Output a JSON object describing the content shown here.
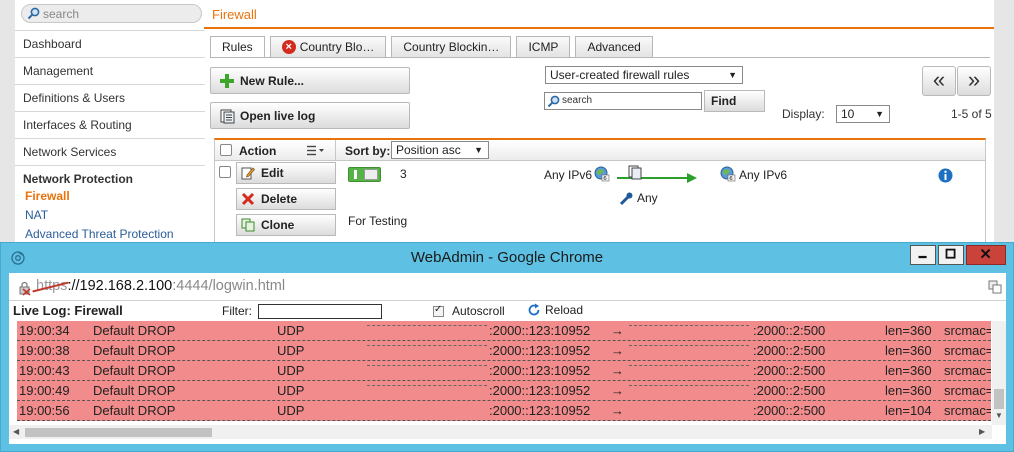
{
  "search": {
    "placeholder": "search"
  },
  "nav": {
    "items": [
      "Dashboard",
      "Management",
      "Definitions & Users",
      "Interfaces & Routing",
      "Network Services"
    ],
    "group": "Network Protection",
    "subitems": [
      "Firewall",
      "NAT",
      "Advanced Threat Protection"
    ]
  },
  "breadcrumb": "Firewall",
  "tabs": [
    "Rules",
    "Country Blo…",
    "Country Blockin…",
    "ICMP",
    "Advanced"
  ],
  "toolbar": {
    "new_rule": "New Rule...",
    "open_live_log": "Open live log",
    "filter_select": "User-created firewall rules",
    "search_placeholder": "search",
    "find": "Find",
    "display_label": "Display:",
    "display_value": "10",
    "range": "1-5 of 5",
    "prev": "«",
    "next": "»"
  },
  "table": {
    "action_header": "Action",
    "sort_label": "Sort by:",
    "sort_value": "Position asc",
    "row": {
      "edit": "Edit",
      "delete": "Delete",
      "clone": "Clone",
      "position": "3",
      "source": "Any IPv6",
      "service": "Any",
      "destination": "Any IPv6",
      "comment": "For Testing"
    }
  },
  "popup": {
    "title": "WebAdmin - Google Chrome",
    "url_scheme": "https",
    "url_host": "://192.168.2.100",
    "url_path": ":4444/logwin.html",
    "log_title": "Live Log: Firewall",
    "filter_label": "Filter:",
    "autoscroll": "Autoscroll",
    "reload": "Reload",
    "rows": [
      {
        "time": "19:00:34",
        "action": "Default DROP",
        "proto": "UDP",
        "src": ":2000::123:10952",
        "arrow": "→",
        "dst": ":2000::2:500",
        "len": "len=360",
        "extra": "srcmac="
      },
      {
        "time": "19:00:38",
        "action": "Default DROP",
        "proto": "UDP",
        "src": ":2000::123:10952",
        "arrow": "→",
        "dst": ":2000::2:500",
        "len": "len=360",
        "extra": "srcmac="
      },
      {
        "time": "19:00:43",
        "action": "Default DROP",
        "proto": "UDP",
        "src": ":2000::123:10952",
        "arrow": "→",
        "dst": ":2000::2:500",
        "len": "len=360",
        "extra": "srcmac="
      },
      {
        "time": "19:00:49",
        "action": "Default DROP",
        "proto": "UDP",
        "src": ":2000::123:10952",
        "arrow": "→",
        "dst": ":2000::2:500",
        "len": "len=360",
        "extra": "srcmac="
      },
      {
        "time": "19:00:56",
        "action": "Default DROP",
        "proto": "UDP",
        "src": ":2000::123:10952",
        "arrow": "→",
        "dst": ":2000::2:500",
        "len": "len=104",
        "extra": "srcmac="
      }
    ]
  },
  "colors": {
    "accent": "#e8730b",
    "log_row": "#f28b8b",
    "title_bar": "#5ec1e3",
    "link": "#2a5c9a"
  }
}
